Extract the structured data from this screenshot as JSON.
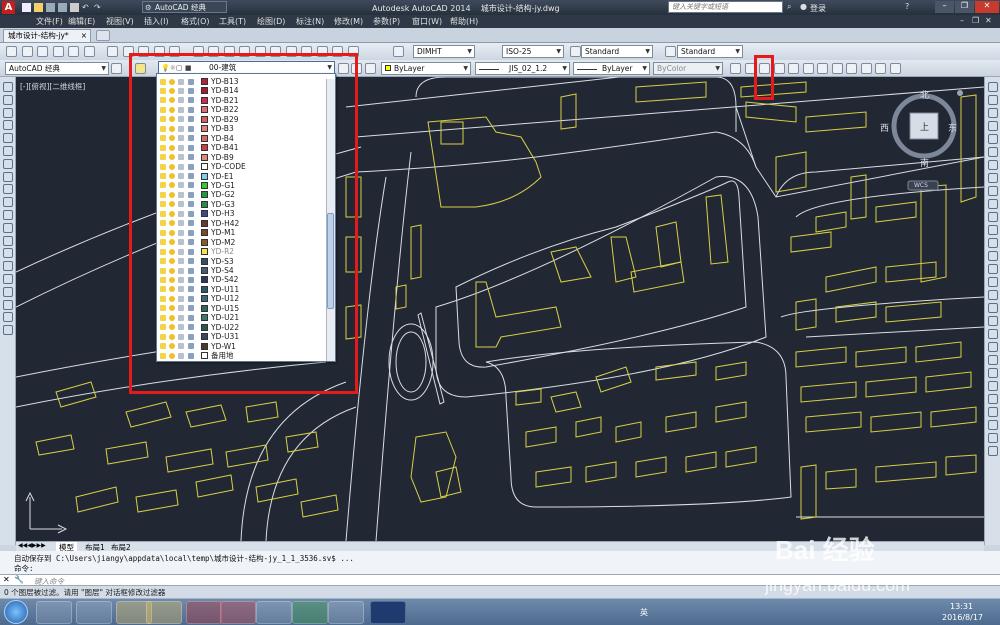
{
  "titlebar": {
    "app_title": "Autodesk AutoCAD 2014",
    "file_title": "城市设计-结构-jy.dwg",
    "workspace": "AutoCAD 经典",
    "search_placeholder": "键入关键字或短语",
    "login": "登录"
  },
  "menu": [
    "文件(F)",
    "编辑(E)",
    "视图(V)",
    "插入(I)",
    "格式(O)",
    "工具(T)",
    "绘图(D)",
    "标注(N)",
    "修改(M)",
    "参数(P)",
    "窗口(W)",
    "帮助(H)"
  ],
  "doc_tab": "城市设计-结构-jy*",
  "toolbar": {
    "dim_style": "DIMHT",
    "iso": "ISO-25",
    "text_style": "Standard",
    "table_style": "Standard",
    "workspace_combo": "AutoCAD 经典",
    "layer_current": "00-建筑",
    "color": "ByLayer",
    "linetype": "JIS_02_1.2",
    "lineweight": "ByLayer",
    "plotstyle": "ByColor"
  },
  "viewport_label": "[-][俯视][二维线框]",
  "layers": [
    {
      "name": "YD-B13",
      "color": "#b0233b"
    },
    {
      "name": "YD-B14",
      "color": "#a31a33"
    },
    {
      "name": "YD-B21",
      "color": "#c92a56"
    },
    {
      "name": "YD-B22",
      "color": "#e06a78"
    },
    {
      "name": "YD-B29",
      "color": "#d95c5c"
    },
    {
      "name": "YD-B3",
      "color": "#e47c7c"
    },
    {
      "name": "YD-B4",
      "color": "#d46a6a"
    },
    {
      "name": "YD-B41",
      "color": "#c93e3e"
    },
    {
      "name": "YD-B9",
      "color": "#e08a7a"
    },
    {
      "name": "YD-CODE",
      "color": "#ffffff"
    },
    {
      "name": "YD-E1",
      "color": "#7ad0f0"
    },
    {
      "name": "YD-G1",
      "color": "#2fcc2f"
    },
    {
      "name": "YD-G2",
      "color": "#1e9a3a"
    },
    {
      "name": "YD-G3",
      "color": "#2a8a4a"
    },
    {
      "name": "YD-H3",
      "color": "#3a4a8a"
    },
    {
      "name": "YD-H42",
      "color": "#6a3a2a"
    },
    {
      "name": "YD-M1",
      "color": "#7a4a2a"
    },
    {
      "name": "YD-M2",
      "color": "#8a5a2a"
    },
    {
      "name": "YD-R2",
      "color": "#f2e64a",
      "muted": true
    },
    {
      "name": "YD-S3",
      "color": "#3a4a6a"
    },
    {
      "name": "YD-S4",
      "color": "#4a5a7a"
    },
    {
      "name": "YD-S42",
      "color": "#2a3a5a"
    },
    {
      "name": "YD-U11",
      "color": "#2a5a6a"
    },
    {
      "name": "YD-U12",
      "color": "#3a6a7a"
    },
    {
      "name": "YD-U15",
      "color": "#2a6a5a"
    },
    {
      "name": "YD-U21",
      "color": "#3a7a6a"
    },
    {
      "name": "YD-U22",
      "color": "#2a5a4a"
    },
    {
      "name": "YD-U31",
      "color": "#3a4a5a"
    },
    {
      "name": "YD-W1",
      "color": "#4a3a2a"
    },
    {
      "name": "备用地",
      "color": "#ffffff"
    }
  ],
  "compass": {
    "n": "北",
    "s": "南",
    "e": "东",
    "w": "西",
    "center": "上",
    "wcs": "WCS"
  },
  "layout_tabs": [
    "模型",
    "布局1",
    "布局2"
  ],
  "command_history": [
    "自动保存到 C:\\Users\\jiangy\\appdata\\local\\temp\\城市设计-结构-jy_1_1_3536.sv$ ...",
    "命令:"
  ],
  "command_placeholder": "键入命令",
  "status_text": "0 个图层被过滤。请用 \"图层\" 对话框修改过滤器",
  "taskbar": {
    "time": "13:31",
    "date": "2016/8/17",
    "ime": "英"
  },
  "watermark": {
    "logo": "Bai 经验",
    "url": "jingyan.baidu.com"
  }
}
